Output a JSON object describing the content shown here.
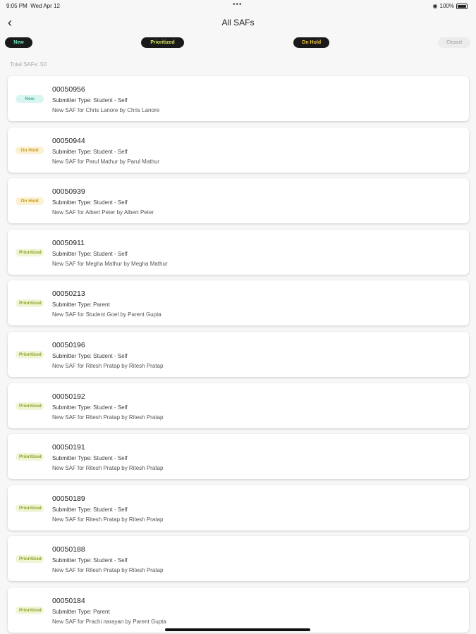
{
  "status": {
    "time": "9:05 PM",
    "date": "Wed Apr 12",
    "battery": "100%"
  },
  "nav": {
    "title": "All SAFs"
  },
  "filters": [
    "New",
    "Prioritized",
    "On Hold",
    "Closed"
  ],
  "total_label": "Total SAFs: 50",
  "submitter_label": "Submitter Type:",
  "items": [
    {
      "id": "00050956",
      "status": "New",
      "type": "Student - Self",
      "desc": "New SAF for Chris Lanore by Chris Lanore"
    },
    {
      "id": "00050944",
      "status": "On Hold",
      "type": "Student - Self",
      "desc": "New SAF for Parul Mathur by Parul Mathur"
    },
    {
      "id": "00050939",
      "status": "On Hold",
      "type": "Student - Self",
      "desc": "New SAF for Albert Peter by Albert Peter"
    },
    {
      "id": "00050911",
      "status": "Prioritized",
      "type": "Student - Self",
      "desc": "New SAF for Megha Mathur by Megha Mathur"
    },
    {
      "id": "00050213",
      "status": "Prioritized",
      "type": "Parent",
      "desc": "New SAF for Student  Goel by Parent Gupta"
    },
    {
      "id": "00050196",
      "status": "Prioritized",
      "type": "Student - Self",
      "desc": "New SAF for Ritesh Pratap by Ritesh Pratap"
    },
    {
      "id": "00050192",
      "status": "Prioritized",
      "type": "Student - Self",
      "desc": "New SAF for Ritesh Pratap by Ritesh Pratap"
    },
    {
      "id": "00050191",
      "status": "Prioritized",
      "type": "Student - Self",
      "desc": "New SAF for Ritesh Pratap by Ritesh Pratap"
    },
    {
      "id": "00050189",
      "status": "Prioritized",
      "type": "Student - Self",
      "desc": "New SAF for Ritesh Pratap by Ritesh Pratap"
    },
    {
      "id": "00050188",
      "status": "Prioritized",
      "type": "Student - Self",
      "desc": "New SAF for Ritesh Pratap by Ritesh Pratap"
    },
    {
      "id": "00050184",
      "status": "Prioritized",
      "type": "Parent",
      "desc": "New SAF for Prachi narayan by Parent Gupta"
    }
  ]
}
